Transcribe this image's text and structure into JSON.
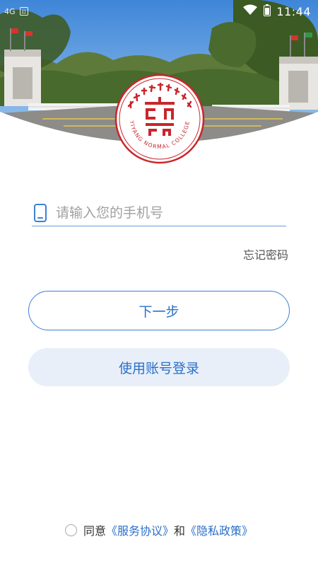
{
  "status_bar": {
    "carrier": "4G",
    "time": "11:44"
  },
  "logo": {
    "english_name": "YIYANG NORMAL COLLEGE"
  },
  "login": {
    "phone_placeholder": "请输入您的手机号",
    "phone_value": "",
    "forgot_password": "忘记密码",
    "next_label": "下一步",
    "account_login_label": "使用账号登录"
  },
  "agreement": {
    "agree_text": "同意",
    "service_link": "《服务协议》",
    "and_text": "和",
    "privacy_link": "《隐私政策》"
  },
  "colors": {
    "accent": "#2a6fc9",
    "seal_red": "#c8262c",
    "secondary_button_bg": "#e8eff8"
  }
}
